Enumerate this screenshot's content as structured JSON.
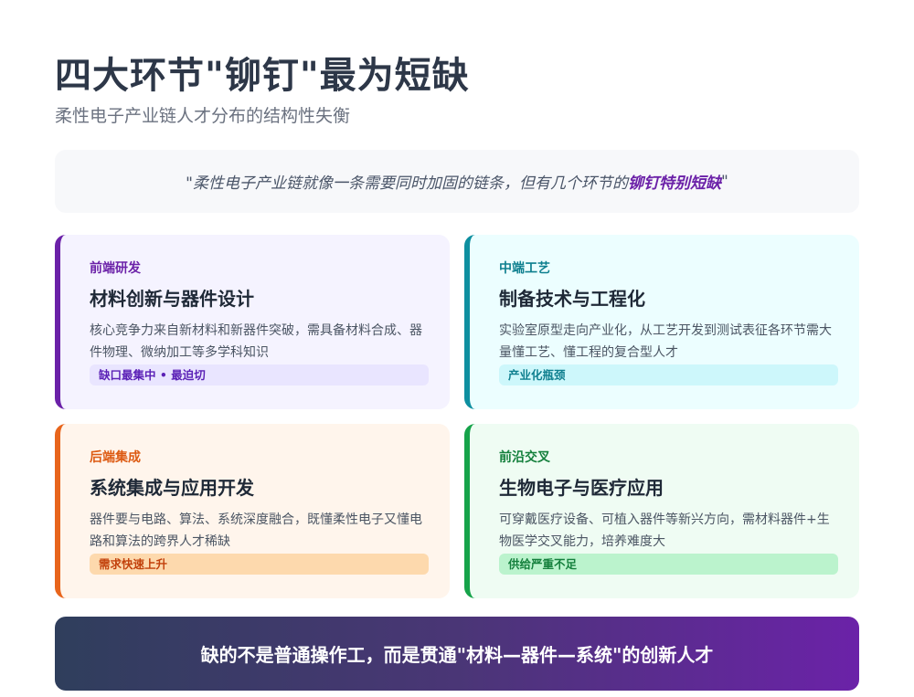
{
  "header": {
    "title": "四大环节\"铆钉\"最为短缺",
    "subtitle": "柔性电子产业链人才分布的结构性失衡"
  },
  "quote": {
    "prefix": "\"柔性电子产业链就像一条需要同时加固的链条，但有几个环节的",
    "highlight": "铆钉特别短缺",
    "suffix": " \""
  },
  "cards": [
    {
      "tag": "前端研发",
      "heading": "材料创新与器件设计",
      "desc": "核心竞争力来自新材料和新器件突破，需具备材料合成、器件物理、微纳加工等多学科知识",
      "pill": "缺口最集中 • 最迫切"
    },
    {
      "tag": "中端工艺",
      "heading": "制备技术与工程化",
      "desc": "实验室原型走向产业化，从工艺开发到测试表征各环节需大量懂工艺、懂工程的复合型人才",
      "pill": "产业化瓶颈"
    },
    {
      "tag": "后端集成",
      "heading": "系统集成与应用开发",
      "desc": "器件要与电路、算法、系统深度融合，既懂柔性电子又懂电路和算法的跨界人才稀缺",
      "pill": "需求快速上升"
    },
    {
      "tag": "前沿交叉",
      "heading": "生物电子与医疗应用",
      "desc": "可穿戴医疗设备、可植入器件等新兴方向，需材料器件+生物医学交叉能力，培养难度大",
      "pill": "供给严重不足"
    }
  ],
  "banner": {
    "text": "缺的不是普通操作工，而是贯通\"材料—器件—系统\"的创新人才"
  },
  "colors": {
    "front": "#6b21a8",
    "mid": "#0e8fa0",
    "back": "#e8651c",
    "frontier": "#16a34a"
  }
}
